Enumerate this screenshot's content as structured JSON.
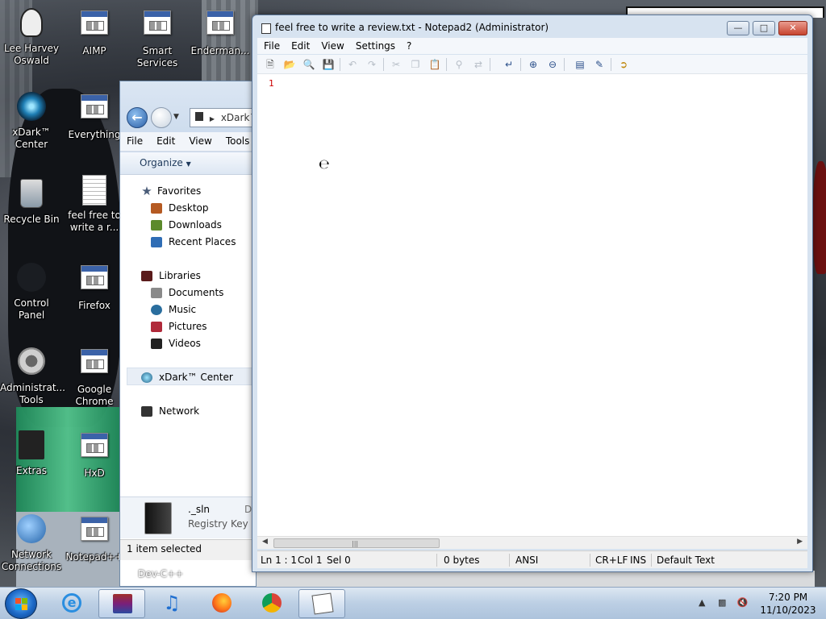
{
  "desktop": {
    "icons": [
      {
        "label": "Lee Harvey Oswald",
        "icon": "person-icon"
      },
      {
        "label": "AIMP",
        "icon": "app-exe-icon"
      },
      {
        "label": "Smart Services",
        "icon": "app-exe-icon"
      },
      {
        "label": "Enderman...",
        "icon": "app-exe-icon"
      },
      {
        "label": "xDark™ Center",
        "icon": "xdark-icon"
      },
      {
        "label": "Everything",
        "icon": "app-exe-icon"
      },
      {
        "label": "Recycle Bin",
        "icon": "recycle-bin-icon"
      },
      {
        "label": "feel free to write a r...",
        "icon": "text-document-icon"
      },
      {
        "label": "Control Panel",
        "icon": "control-panel-icon"
      },
      {
        "label": "Firefox",
        "icon": "app-exe-icon"
      },
      {
        "label": "Administrat... Tools",
        "icon": "gear-icon"
      },
      {
        "label": "Google Chrome",
        "icon": "app-exe-icon"
      },
      {
        "label": "Extras",
        "icon": "folder-icon"
      },
      {
        "label": "HxD",
        "icon": "app-exe-icon"
      },
      {
        "label": "Network Connections",
        "icon": "network-icon"
      },
      {
        "label": "Notepad++",
        "icon": "app-exe-icon"
      }
    ]
  },
  "explorer": {
    "address": "xDark™ C",
    "menu": [
      "File",
      "Edit",
      "View",
      "Tools"
    ],
    "organize": "Organize",
    "nav": {
      "favorites": "Favorites",
      "desktop": "Desktop",
      "downloads": "Downloads",
      "recent": "Recent Places",
      "libraries": "Libraries",
      "documents": "Documents",
      "music": "Music",
      "pictures": "Pictures",
      "videos": "Videos",
      "xdark": "xDark™ Center",
      "network": "Network"
    },
    "details": {
      "name": "._sln",
      "type": "Registry Key",
      "extra": "Da"
    },
    "status": "1 item selected",
    "below_label": "Dev-C++"
  },
  "notepad": {
    "title": "feel free to write a review.txt - Notepad2 (Administrator)",
    "menu": [
      "File",
      "Edit",
      "View",
      "Settings",
      "?"
    ],
    "line_number": "1",
    "status": {
      "position": "Ln 1 : 1",
      "col": "Col 1",
      "sel": "Sel 0",
      "size": "0 bytes",
      "encoding": "ANSI",
      "eol": "CR+LF",
      "mode": "INS",
      "scheme": "Default Text"
    }
  },
  "taskbar": {
    "time": "7:20 PM",
    "date": "11/10/2023"
  },
  "colors": {
    "taskbar_bg": "#bccfe4",
    "line_number": "#cc0000",
    "close_button": "#c7442f"
  }
}
